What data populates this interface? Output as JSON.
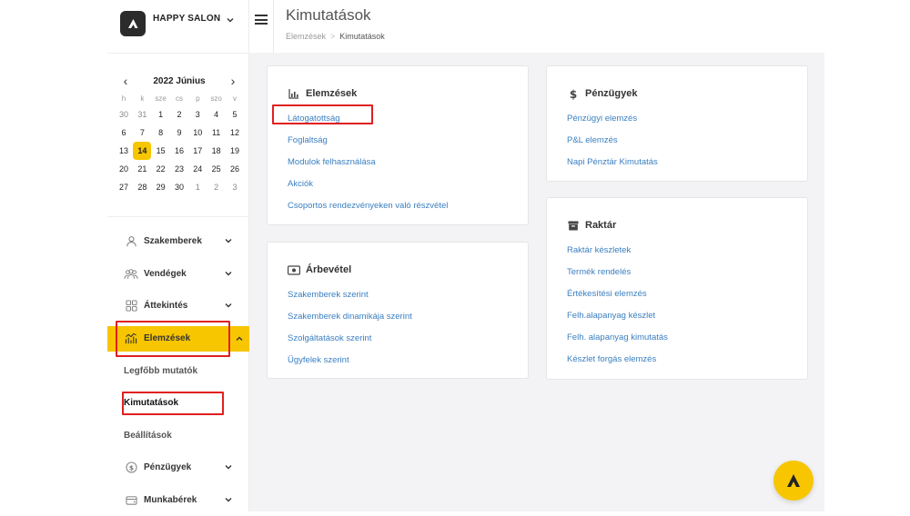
{
  "brand": {
    "name": "HAPPY SALON"
  },
  "calendar": {
    "title": "2022 Június",
    "weekdays": [
      "h",
      "k",
      "sze",
      "cs",
      "p",
      "szo",
      "v"
    ],
    "weeks": [
      [
        "30",
        "31",
        "1",
        "2",
        "3",
        "4",
        "5"
      ],
      [
        "6",
        "7",
        "8",
        "9",
        "10",
        "11",
        "12"
      ],
      [
        "13",
        "14",
        "15",
        "16",
        "17",
        "18",
        "19"
      ],
      [
        "20",
        "21",
        "22",
        "23",
        "24",
        "25",
        "26"
      ],
      [
        "27",
        "28",
        "29",
        "30",
        "1",
        "2",
        "3"
      ]
    ],
    "today": "14"
  },
  "sidebar": {
    "items": [
      {
        "label": "Szakemberek",
        "icon": "user-icon"
      },
      {
        "label": "Vendégek",
        "icon": "users-icon"
      },
      {
        "label": "Áttekintés",
        "icon": "grid-icon"
      },
      {
        "label": "Elemzések",
        "icon": "chart-icon",
        "active": true
      },
      {
        "label": "Pénzügyek",
        "icon": "dollar-circle-icon"
      },
      {
        "label": "Munkabérek",
        "icon": "wallet-icon"
      }
    ],
    "sub_items": [
      "Legfőbb mutatók",
      "Kimutatások",
      "Beállítások"
    ]
  },
  "header": {
    "title": "Kimutatások",
    "breadcrumb": {
      "parent": "Elemzések",
      "separator": ">",
      "current": "Kimutatások"
    }
  },
  "cards": {
    "elemzesek": {
      "title": "Elemzések",
      "links": [
        "Látogatottság",
        "Foglaltság",
        "Modulok felhasználása",
        "Akciók",
        "Csoportos rendezvényeken való részvétel"
      ]
    },
    "arbevetel": {
      "title": "Árbevétel",
      "links": [
        "Szakemberek szerint",
        "Szakemberek dinamikája szerint",
        "Szolgáltatások szerint",
        "Ügyfelek szerint"
      ]
    },
    "penzugyek": {
      "title": "Pénzügyek",
      "links": [
        "Pénzügyi elemzés",
        "P&L elemzés",
        "Napi Pénztár Kimutatás"
      ]
    },
    "raktar": {
      "title": "Raktár",
      "links": [
        "Raktár készletek",
        "Termék rendelés",
        "Értékesítési elemzés",
        "Felh.alapanyag készlet",
        "Felh. alapanyag kimutatás",
        "Készlet forgás elemzés"
      ]
    }
  },
  "colors": {
    "accent": "#f7c600",
    "link": "#3a7fc1",
    "highlight": "#e02020"
  }
}
